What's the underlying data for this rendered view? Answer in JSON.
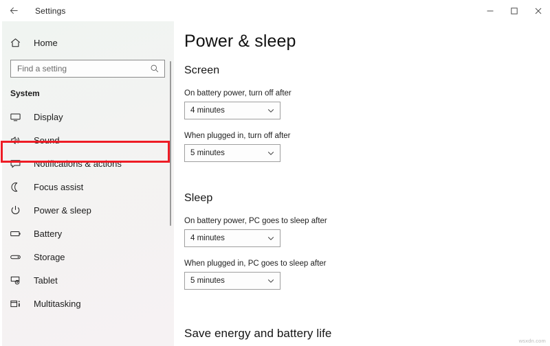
{
  "window": {
    "title": "Settings",
    "back_icon": "back-arrow-icon",
    "controls": [
      {
        "name": "minimize",
        "label": "—"
      },
      {
        "name": "maximize",
        "label": "□"
      },
      {
        "name": "close",
        "label": "✕"
      }
    ]
  },
  "sidebar": {
    "home_label": "Home",
    "home_icon": "home-icon",
    "search": {
      "placeholder": "Find a setting",
      "value": "",
      "icon": "search-icon"
    },
    "group_title": "System",
    "items": [
      {
        "label": "Display",
        "icon": "monitor-icon",
        "selected": false
      },
      {
        "label": "Sound",
        "icon": "speaker-icon",
        "selected": false
      },
      {
        "label": "Notifications & actions",
        "icon": "notification-icon",
        "selected": false
      },
      {
        "label": "Focus assist",
        "icon": "moon-icon",
        "selected": false
      },
      {
        "label": "Power & sleep",
        "icon": "power-icon",
        "selected": true
      },
      {
        "label": "Battery",
        "icon": "battery-icon",
        "selected": false
      },
      {
        "label": "Storage",
        "icon": "storage-icon",
        "selected": false
      },
      {
        "label": "Tablet",
        "icon": "tablet-icon",
        "selected": false
      },
      {
        "label": "Multitasking",
        "icon": "multitasking-icon",
        "selected": false
      }
    ],
    "highlight_color": "#ee1c25"
  },
  "main": {
    "page_title": "Power & sleep",
    "screen_section": {
      "heading": "Screen",
      "fields": [
        {
          "label": "On battery power, turn off after",
          "value": "4 minutes"
        },
        {
          "label": "When plugged in, turn off after",
          "value": "5 minutes"
        }
      ]
    },
    "sleep_section": {
      "heading": "Sleep",
      "fields": [
        {
          "label": "On battery power, PC goes to sleep after",
          "value": "4 minutes"
        },
        {
          "label": "When plugged in, PC goes to sleep after",
          "value": "5 minutes"
        }
      ]
    },
    "energy_section": {
      "heading": "Save energy and battery life"
    }
  },
  "watermark": "wsxdn.com"
}
